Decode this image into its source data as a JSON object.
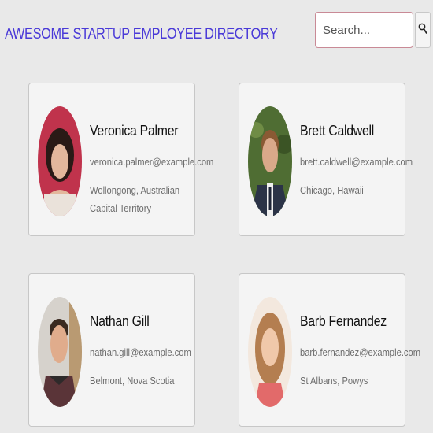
{
  "header": {
    "title": "AWESOME STARTUP EMPLOYEE DIRECTORY"
  },
  "search": {
    "placeholder": "Search..."
  },
  "employees": [
    {
      "name": "Veronica Palmer",
      "email": "veronica.palmer@example.com",
      "location": "Wollongong, Australian Capital Territory"
    },
    {
      "name": "Brett Caldwell",
      "email": "brett.caldwell@example.com",
      "location": "Chicago, Hawaii"
    },
    {
      "name": "Nathan Gill",
      "email": "nathan.gill@example.com",
      "location": "Belmont, Nova Scotia"
    },
    {
      "name": "Barb Fernandez",
      "email": "barb.fernandez@example.com",
      "location": "St Albans, Powys"
    }
  ],
  "colors": {
    "accent": "#4a3ad8",
    "search_border": "#c98a96",
    "background": "#e9e9e9",
    "card": "#f4f4f4"
  }
}
